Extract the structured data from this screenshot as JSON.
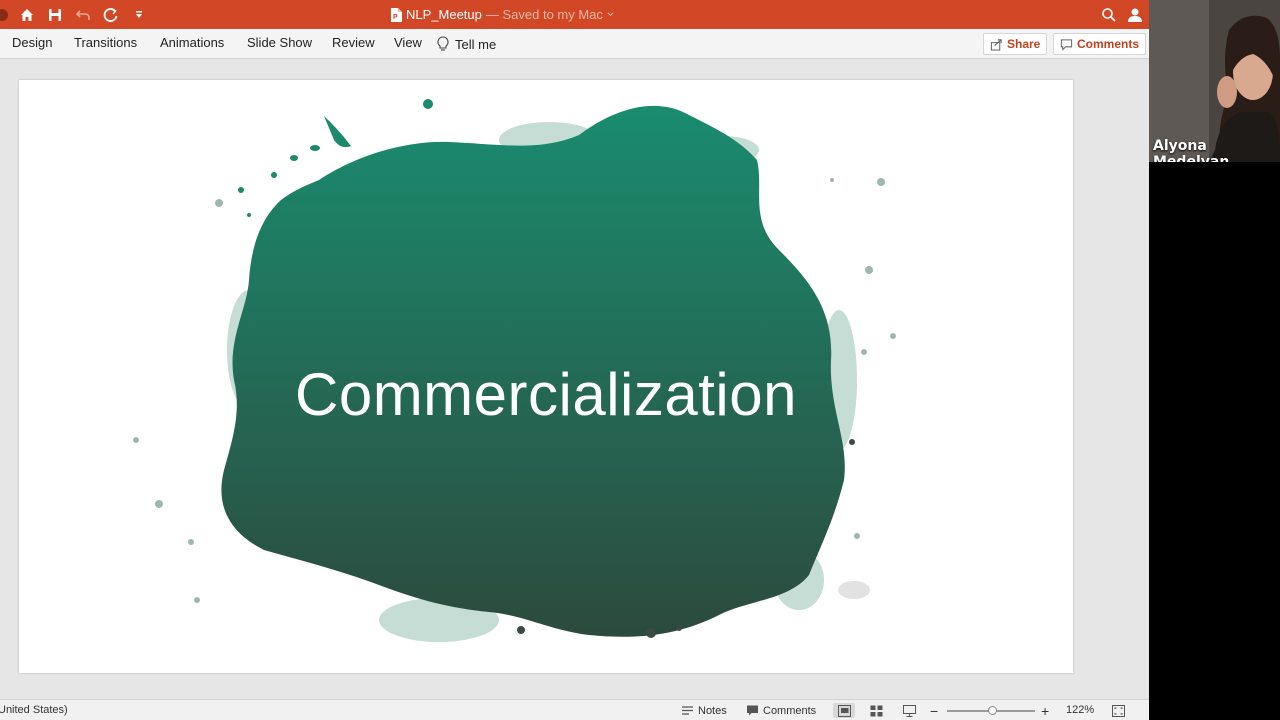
{
  "window": {
    "doc_name": "NLP_Meetup",
    "saved_status": "— Saved to my Mac"
  },
  "ribbon": {
    "tabs": [
      "Design",
      "Transitions",
      "Animations",
      "Slide Show",
      "Review",
      "View"
    ],
    "tell_me": "Tell me",
    "share_label": "Share",
    "comments_label": "Comments"
  },
  "slide": {
    "title": "Commercialization",
    "splash_color_top": "#1a8c6e",
    "splash_color_bottom": "#2c4a3e"
  },
  "statusbar": {
    "language": "United States)",
    "notes_label": "Notes",
    "comments_label": "Comments",
    "zoom_percent": "122%",
    "zoom_level": 0.52
  },
  "video": {
    "participant_name": "Alyona Medelyan"
  },
  "colors": {
    "accent": "#d24726",
    "ribbon_bg": "#f4f4f4",
    "accent_text": "#c0441f"
  },
  "icons": {
    "home": "home-icon",
    "save": "save-icon",
    "undo": "undo-icon",
    "redo": "redo-icon",
    "customize": "customize-icon",
    "search": "search-icon",
    "user": "user-icon",
    "lightbulb": "lightbulb-icon"
  }
}
